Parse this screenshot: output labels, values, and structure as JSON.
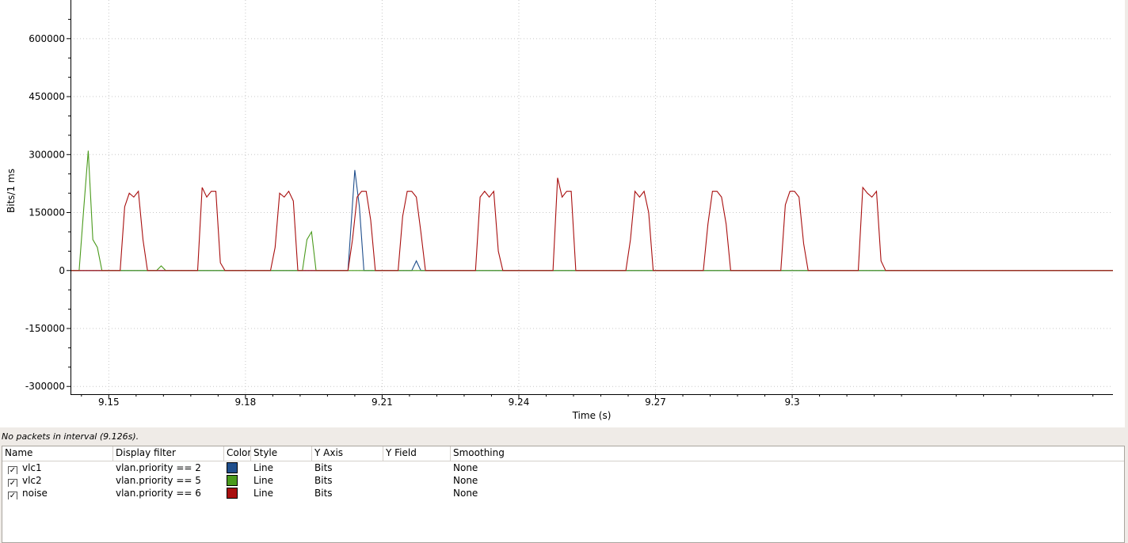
{
  "chart_data": {
    "type": "line",
    "xlabel": "Time (s)",
    "ylabel": "Bits/1 ms",
    "xlim": [
      9.1416,
      9.3704
    ],
    "ylim": [
      -320000,
      700000
    ],
    "x_ticks": [
      9.15,
      9.18,
      9.21,
      9.24,
      9.27,
      9.3
    ],
    "x_tick_labels": [
      "9.15",
      "9.18",
      "9.21",
      "9.24",
      "9.27",
      "9.3"
    ],
    "y_ticks": [
      -300000,
      -150000,
      0,
      150000,
      300000,
      450000,
      600000
    ],
    "y_tick_labels": [
      "-300000",
      "-150000",
      "0",
      "150000",
      "300000",
      "450000",
      "600000"
    ],
    "grid": true,
    "series": [
      {
        "name": "vlc1",
        "color": "#1f4e8c",
        "points": [
          [
            9.1416,
            0
          ],
          [
            9.2025,
            0
          ],
          [
            9.204,
            260000
          ],
          [
            9.205,
            165000
          ],
          [
            9.206,
            0
          ],
          [
            9.2165,
            0
          ],
          [
            9.2175,
            25000
          ],
          [
            9.2185,
            0
          ],
          [
            9.3704,
            0
          ]
        ]
      },
      {
        "name": "vlc2",
        "color": "#4a9a1c",
        "points": [
          [
            9.1416,
            0
          ],
          [
            9.1435,
            0
          ],
          [
            9.1445,
            160000
          ],
          [
            9.1455,
            310000
          ],
          [
            9.1465,
            80000
          ],
          [
            9.1475,
            60000
          ],
          [
            9.1485,
            0
          ],
          [
            9.1605,
            0
          ],
          [
            9.1615,
            12000
          ],
          [
            9.1625,
            0
          ],
          [
            9.1925,
            0
          ],
          [
            9.1935,
            80000
          ],
          [
            9.1945,
            100000
          ],
          [
            9.1955,
            0
          ],
          [
            9.3704,
            0
          ]
        ]
      },
      {
        "name": "noise",
        "color": "#a80e0e",
        "points": [
          [
            9.1416,
            0
          ],
          [
            9.1525,
            0
          ],
          [
            9.1535,
            165000
          ],
          [
            9.1545,
            200000
          ],
          [
            9.1555,
            190000
          ],
          [
            9.1565,
            205000
          ],
          [
            9.1575,
            80000
          ],
          [
            9.1585,
            0
          ],
          [
            9.1695,
            0
          ],
          [
            9.1705,
            215000
          ],
          [
            9.1715,
            190000
          ],
          [
            9.1725,
            205000
          ],
          [
            9.1735,
            205000
          ],
          [
            9.1745,
            20000
          ],
          [
            9.1755,
            0
          ],
          [
            9.1855,
            0
          ],
          [
            9.1865,
            60000
          ],
          [
            9.1875,
            200000
          ],
          [
            9.1885,
            190000
          ],
          [
            9.1895,
            205000
          ],
          [
            9.1905,
            180000
          ],
          [
            9.1915,
            0
          ],
          [
            9.2025,
            0
          ],
          [
            9.2035,
            80000
          ],
          [
            9.2045,
            190000
          ],
          [
            9.2055,
            205000
          ],
          [
            9.2065,
            205000
          ],
          [
            9.2075,
            130000
          ],
          [
            9.2085,
            0
          ],
          [
            9.2135,
            0
          ],
          [
            9.2145,
            140000
          ],
          [
            9.2155,
            205000
          ],
          [
            9.2165,
            205000
          ],
          [
            9.2175,
            190000
          ],
          [
            9.2185,
            100000
          ],
          [
            9.2195,
            0
          ],
          [
            9.2305,
            0
          ],
          [
            9.2315,
            190000
          ],
          [
            9.2325,
            205000
          ],
          [
            9.2335,
            190000
          ],
          [
            9.2345,
            205000
          ],
          [
            9.2355,
            50000
          ],
          [
            9.2365,
            0
          ],
          [
            9.2475,
            0
          ],
          [
            9.2485,
            240000
          ],
          [
            9.2495,
            190000
          ],
          [
            9.2505,
            205000
          ],
          [
            9.2515,
            205000
          ],
          [
            9.2525,
            0
          ],
          [
            9.2635,
            0
          ],
          [
            9.2645,
            80000
          ],
          [
            9.2655,
            205000
          ],
          [
            9.2665,
            190000
          ],
          [
            9.2675,
            205000
          ],
          [
            9.2685,
            150000
          ],
          [
            9.2695,
            0
          ],
          [
            9.2805,
            0
          ],
          [
            9.2815,
            120000
          ],
          [
            9.2825,
            205000
          ],
          [
            9.2835,
            205000
          ],
          [
            9.2845,
            190000
          ],
          [
            9.2855,
            120000
          ],
          [
            9.2865,
            0
          ],
          [
            9.2975,
            0
          ],
          [
            9.2985,
            170000
          ],
          [
            9.2995,
            205000
          ],
          [
            9.3005,
            205000
          ],
          [
            9.3015,
            190000
          ],
          [
            9.3025,
            70000
          ],
          [
            9.3035,
            0
          ],
          [
            9.3145,
            0
          ],
          [
            9.3155,
            215000
          ],
          [
            9.3165,
            200000
          ],
          [
            9.3175,
            190000
          ],
          [
            9.3185,
            205000
          ],
          [
            9.3195,
            25000
          ],
          [
            9.3205,
            0
          ],
          [
            9.3704,
            0
          ]
        ]
      }
    ]
  },
  "status_hint": "No packets in interval (9.126s).",
  "graph_table": {
    "headers": {
      "name": "Name",
      "display_filter": "Display filter",
      "color": "Color",
      "style": "Style",
      "y_axis": "Y Axis",
      "y_field": "Y Field",
      "smoothing": "Smoothing"
    },
    "rows": [
      {
        "enabled": true,
        "check": "✓",
        "name": "vlc1",
        "display_filter": "vlan.priority == 2",
        "color": "#1f4e8c",
        "style": "Line",
        "y_axis": "Bits",
        "y_field": "",
        "smoothing": "None"
      },
      {
        "enabled": true,
        "check": "✓",
        "name": "vlc2",
        "display_filter": "vlan.priority == 5",
        "color": "#4a9a1c",
        "style": "Line",
        "y_axis": "Bits",
        "y_field": "",
        "smoothing": "None"
      },
      {
        "enabled": true,
        "check": "✓",
        "name": "noise",
        "display_filter": "vlan.priority == 6",
        "color": "#a80e0e",
        "style": "Line",
        "y_axis": "Bits",
        "y_field": "",
        "smoothing": "None"
      }
    ]
  }
}
